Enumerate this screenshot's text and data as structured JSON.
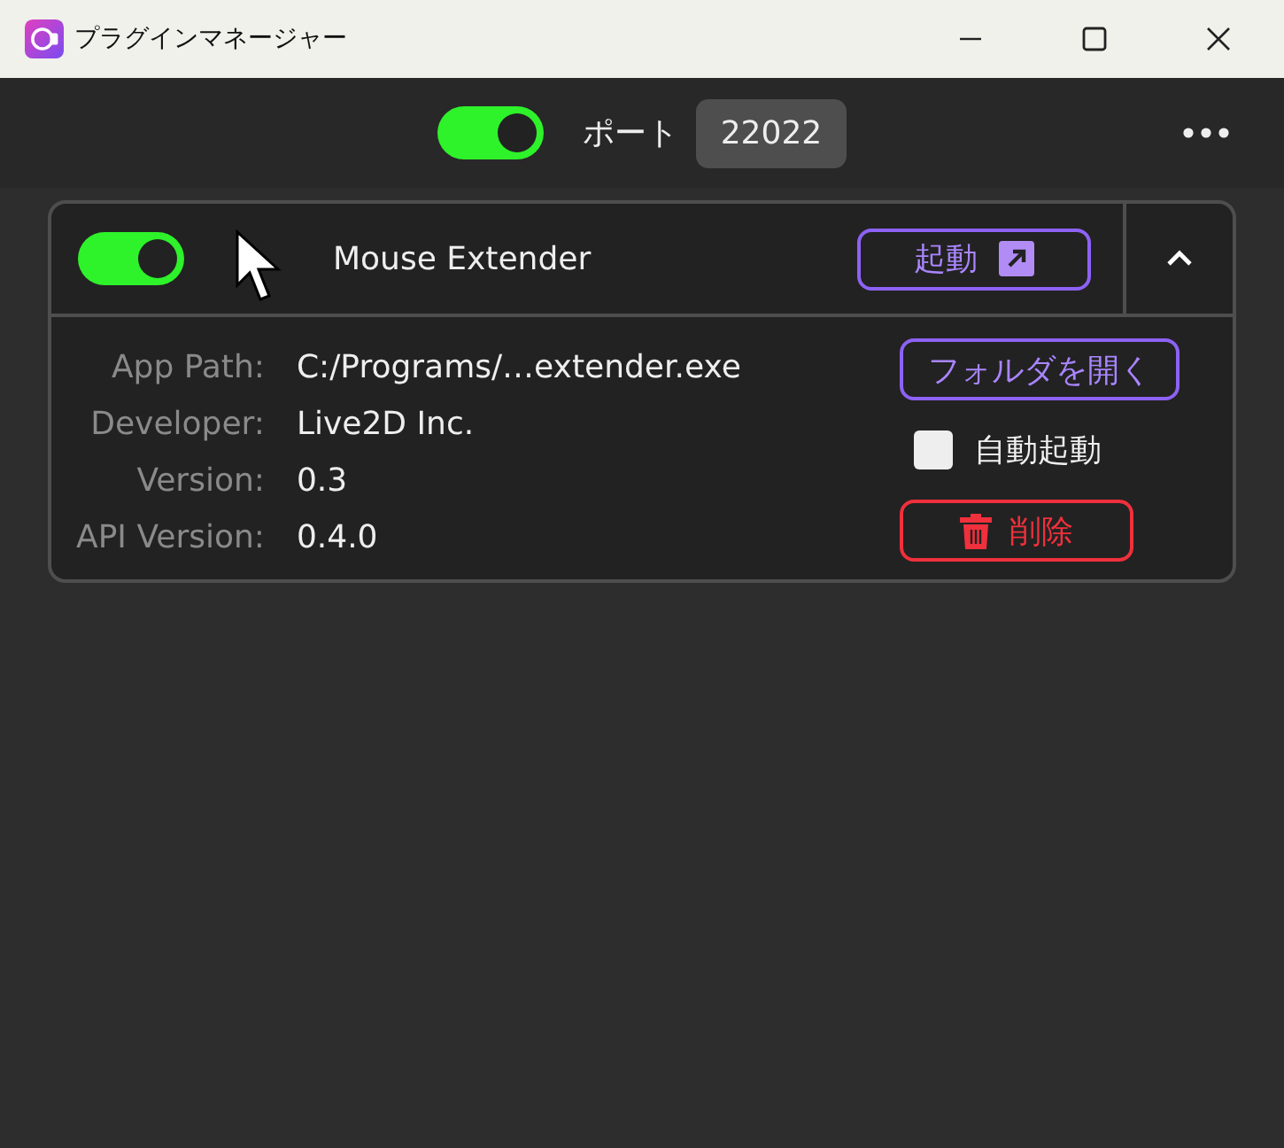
{
  "window": {
    "title": "プラグインマネージャー"
  },
  "toolbar": {
    "server_on": true,
    "port_label": "ポート",
    "port": "22022"
  },
  "plugins": [
    {
      "enabled": true,
      "name": "Mouse Extender",
      "expanded": true,
      "launch_label": "起動",
      "open_folder_label": "フォルダを開く",
      "auto_start_label": "自動起動",
      "auto_start_checked": false,
      "delete_label": "削除",
      "details": [
        {
          "label": "App Path:",
          "value": "C:/Programs/…extender.exe"
        },
        {
          "label": "Developer:",
          "value": "Live2D Inc."
        },
        {
          "label": "Version:",
          "value": "0.3"
        },
        {
          "label": "API Version:",
          "value": "0.4.0"
        }
      ]
    }
  ]
}
